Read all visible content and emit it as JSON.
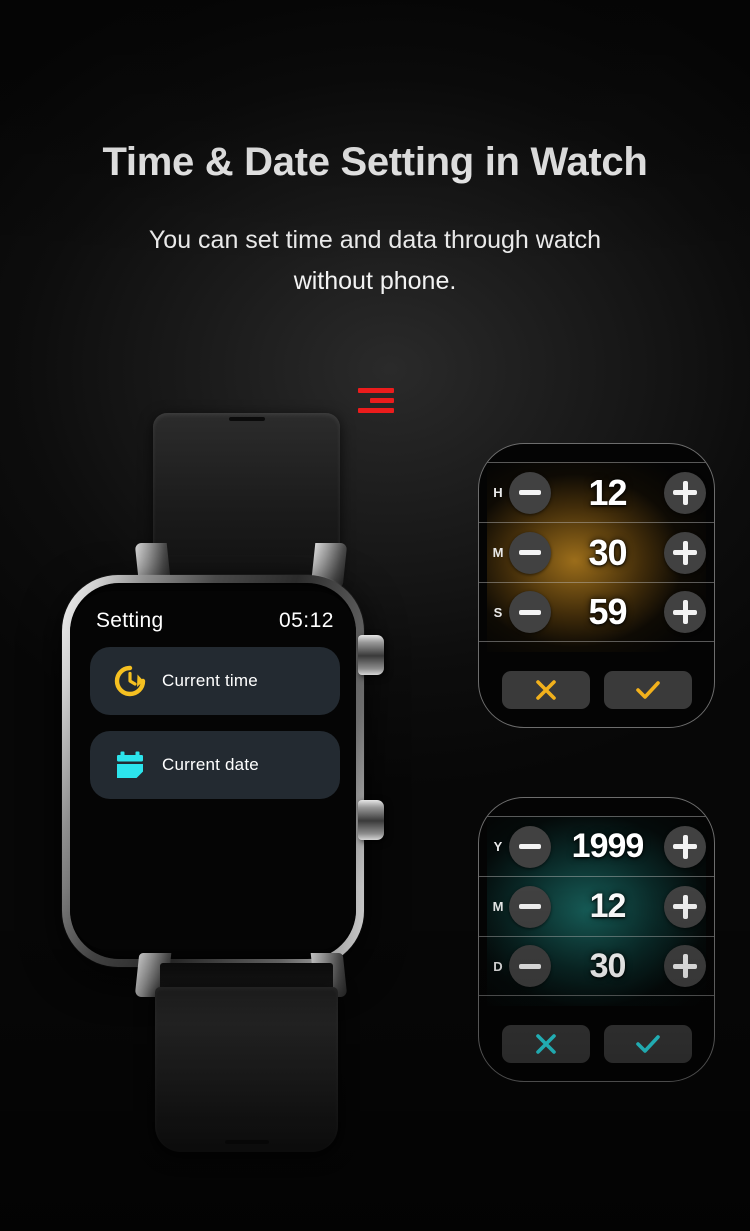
{
  "header": {
    "title": "Time & Date Setting in Watch",
    "subtitle": "You can set time and data through watch without phone."
  },
  "brand": {
    "logo_name": "three-bar-logo",
    "color": "#ec1c1c"
  },
  "watch": {
    "screen": {
      "header_label": "Setting",
      "header_time": "05:12",
      "items": [
        {
          "icon": "clock-restore-icon",
          "label": "Current time",
          "color": "#f5c021"
        },
        {
          "icon": "calendar-icon",
          "label": "Current date",
          "color": "#2ce4ec"
        }
      ]
    },
    "side_buttons": [
      "crown-button",
      "function-button"
    ]
  },
  "time_panel": {
    "accent": "#f2b11c",
    "rows": [
      {
        "unit": "H",
        "value": "12"
      },
      {
        "unit": "M",
        "value": "30"
      },
      {
        "unit": "S",
        "value": "59"
      }
    ],
    "cancel_icon": "cross-icon",
    "confirm_icon": "check-icon"
  },
  "date_panel": {
    "accent": "#2ce4ec",
    "rows": [
      {
        "unit": "Y",
        "value": "1999"
      },
      {
        "unit": "M",
        "value": "12"
      },
      {
        "unit": "D",
        "value": "30"
      }
    ],
    "cancel_icon": "cross-icon",
    "confirm_icon": "check-icon"
  },
  "stepper": {
    "decrement_icon": "minus-icon",
    "increment_icon": "plus-icon"
  }
}
